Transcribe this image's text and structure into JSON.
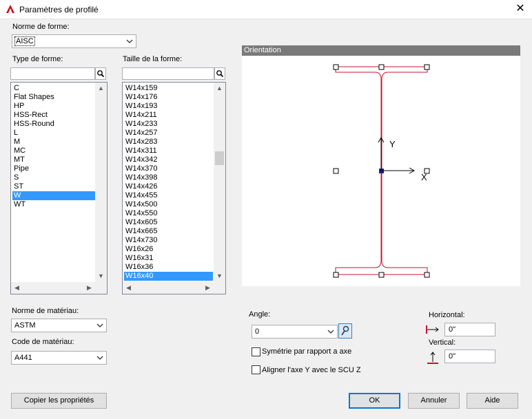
{
  "window": {
    "title": "Paramètres de profilé",
    "close_glyph": "✕"
  },
  "shape_standard": {
    "label": "Norme de forme:",
    "value": "AISC"
  },
  "shape_type": {
    "label": "Type de forme:",
    "search_value": "",
    "items": [
      "C",
      "Flat Shapes",
      "HP",
      "HSS-Rect",
      "HSS-Round",
      "L",
      "M",
      "MC",
      "MT",
      "Pipe",
      "S",
      "ST",
      "W",
      "WT"
    ],
    "selected": "W"
  },
  "shape_size": {
    "label": "Taille de la forme:",
    "search_value": "",
    "items": [
      "W14x159",
      "W14x176",
      "W14x193",
      "W14x211",
      "W14x233",
      "W14x257",
      "W14x283",
      "W14x311",
      "W14x342",
      "W14x370",
      "W14x398",
      "W14x426",
      "W14x455",
      "W14x500",
      "W14x550",
      "W14x605",
      "W14x665",
      "W14x730",
      "W16x26",
      "W16x31",
      "W16x36",
      "W16x40"
    ],
    "selected": "W16x40"
  },
  "orientation": {
    "header": "Orientation",
    "axis_y": "Y",
    "axis_x": "X"
  },
  "material_standard": {
    "label": "Norme de matériau:",
    "value": "ASTM"
  },
  "material_code": {
    "label": "Code de matériau:",
    "value": "A441"
  },
  "angle": {
    "label": "Angle:",
    "value": "0"
  },
  "mirror": {
    "label": "Symétrie par rapport a axe",
    "checked": false
  },
  "align": {
    "label": "Aligner l'axe Y avec le SCU Z",
    "checked": false
  },
  "offset": {
    "horizontal_label": "Horizontal:",
    "horizontal_value": "0\"",
    "vertical_label": "Vertical:",
    "vertical_value": "0\""
  },
  "buttons": {
    "copy": "Copier les propriétés",
    "ok": "OK",
    "cancel": "Annuler",
    "help": "Aide"
  },
  "colors": {
    "selection": "#3399ff",
    "profile_outline": "#c8102e",
    "grip_fill": "#1a237e",
    "panel_header": "#7a7a7a"
  }
}
